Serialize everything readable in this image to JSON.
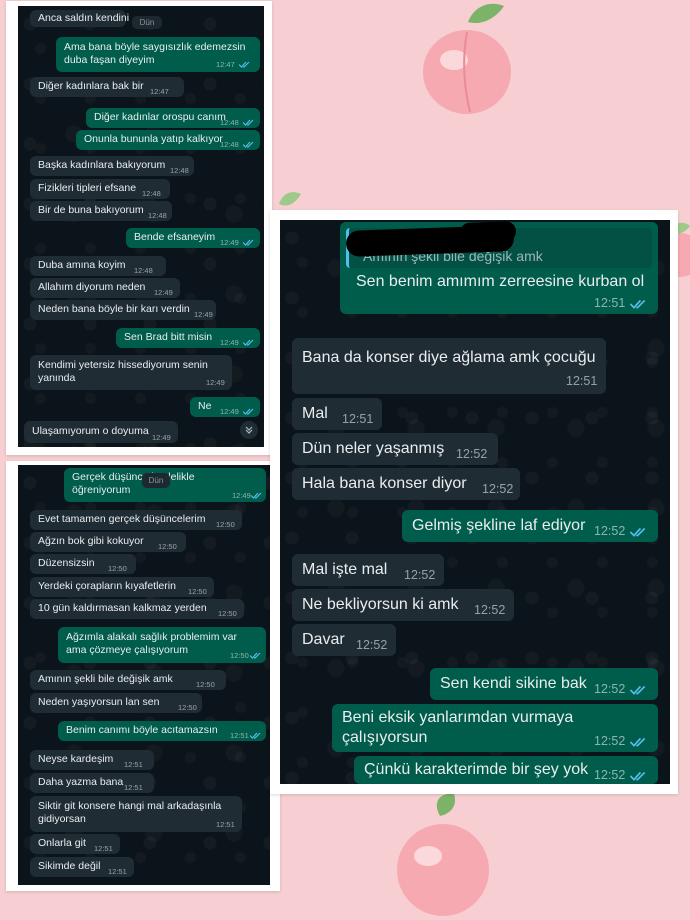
{
  "panel_a": {
    "date_chip": "Dün",
    "messages": [
      {
        "text": "Anca saldın kendini",
        "dir": "in",
        "time": ""
      },
      {
        "text": "Ama bana böyle saygısızlık edemezsin\nduba faşan diyeyim",
        "dir": "out",
        "time": "12:47"
      },
      {
        "text": "Diğer kadınlara bak bir",
        "dir": "in",
        "time": "12:47"
      },
      {
        "text": "Diğer kadınlar orospu canım",
        "dir": "out",
        "time": "12:48"
      },
      {
        "text": "Onunla bununla yatıp kalkıyor",
        "dir": "out",
        "time": "12:48"
      },
      {
        "text": "Başka kadınlara bakıyorum",
        "dir": "in",
        "time": "12:48"
      },
      {
        "text": "Fizikleri tipleri efsane",
        "dir": "in",
        "time": "12:48"
      },
      {
        "text": "Bir de buna bakıyorum",
        "dir": "in",
        "time": "12:48"
      },
      {
        "text": "Bende efsaneyim",
        "dir": "out",
        "time": "12:49"
      },
      {
        "text": "Duba amına koyim",
        "dir": "in",
        "time": "12:48"
      },
      {
        "text": "Allahım diyorum neden",
        "dir": "in",
        "time": "12:49"
      },
      {
        "text": "Neden bana böyle bir karı verdin",
        "dir": "in",
        "time": "12:49"
      },
      {
        "text": "Sen Brad bitt misin",
        "dir": "out",
        "time": "12:49"
      },
      {
        "text": "Kendimi yetersiz hissediyorum senin\nyanında",
        "dir": "in",
        "time": "12:49"
      },
      {
        "text": "Ne",
        "dir": "out",
        "time": "12:49"
      },
      {
        "text": "Ulaşamıyorum o doyuma",
        "dir": "in",
        "time": "12:49"
      }
    ]
  },
  "panel_b": {
    "date_chip": "Dün",
    "messages": [
      {
        "text": "Gerçek düşünce böylelikle\nöğreniyorum",
        "dir": "out",
        "time": "12:49"
      },
      {
        "text": "Evet tamamen gerçek düşüncelerim",
        "dir": "in",
        "time": "12:50"
      },
      {
        "text": "Ağzın bok gibi kokuyor",
        "dir": "in",
        "time": "12:50"
      },
      {
        "text": "Düzensizsin",
        "dir": "in",
        "time": "12:50"
      },
      {
        "text": "Yerdeki çorapların kıyafetlerin",
        "dir": "in",
        "time": "12:50"
      },
      {
        "text": "10 gün kaldırmasan kalkmaz yerden",
        "dir": "in",
        "time": "12:50"
      },
      {
        "text": "Ağzımla alakalı sağlık problemim var\nama çözmeye çalışıyorum",
        "dir": "out",
        "time": "12:50"
      },
      {
        "text": "Amının şekli bile değişik amk",
        "dir": "in",
        "time": "12:50"
      },
      {
        "text": "Neden yaşıyorsun lan sen",
        "dir": "in",
        "time": "12:50"
      },
      {
        "text": "Benim canımı böyle acıtamazsın",
        "dir": "out",
        "time": "12:51"
      },
      {
        "text": "Neyse kardeşim",
        "dir": "in",
        "time": "12:51"
      },
      {
        "text": "Daha yazma bana",
        "dir": "in",
        "time": "12:51"
      },
      {
        "text": "Siktir git konsere hangi mal arkadaşınla\ngidiyorsan",
        "dir": "in",
        "time": "12:51"
      },
      {
        "text": "Onlarla git",
        "dir": "in",
        "time": "12:51"
      },
      {
        "text": "Sikimde değil",
        "dir": "in",
        "time": "12:51"
      }
    ]
  },
  "panel_c": {
    "quoted_text": "Amının şekli bile değişik amk",
    "messages": [
      {
        "text": "Sen benim amımım zerreesine kurban ol",
        "dir": "out",
        "time": "12:51"
      },
      {
        "text": "Bana da konser diye ağlama amk çocuğu",
        "dir": "in",
        "time": "12:51"
      },
      {
        "text": "Mal",
        "dir": "in",
        "time": "12:51"
      },
      {
        "text": "Dün neler yaşanmış",
        "dir": "in",
        "time": "12:52"
      },
      {
        "text": "Hala bana konser diyor",
        "dir": "in",
        "time": "12:52"
      },
      {
        "text": "Gelmiş şekline laf ediyor",
        "dir": "out",
        "time": "12:52"
      },
      {
        "text": "Mal işte mal",
        "dir": "in",
        "time": "12:52"
      },
      {
        "text": "Ne bekliyorsun ki amk",
        "dir": "in",
        "time": "12:52"
      },
      {
        "text": "Davar",
        "dir": "in",
        "time": "12:52"
      },
      {
        "text": "Sen kendi sikine bak",
        "dir": "out",
        "time": "12:52"
      },
      {
        "text": "Beni eksik yanlarımdan vurmaya\nçalışıyorsun",
        "dir": "out",
        "time": "12:52"
      },
      {
        "text": "Çünkü karakterimde bir şey yok",
        "dir": "out",
        "time": "12:52"
      }
    ]
  },
  "colors": {
    "background": "#f7cfd3",
    "chat_bg": "#0b141a",
    "bubble_in": "#202c33",
    "bubble_out": "#005c4b",
    "read_tick": "#53bdeb"
  },
  "icons": [
    "peach-icon",
    "read-receipt-icon",
    "scroll-down-icon"
  ]
}
